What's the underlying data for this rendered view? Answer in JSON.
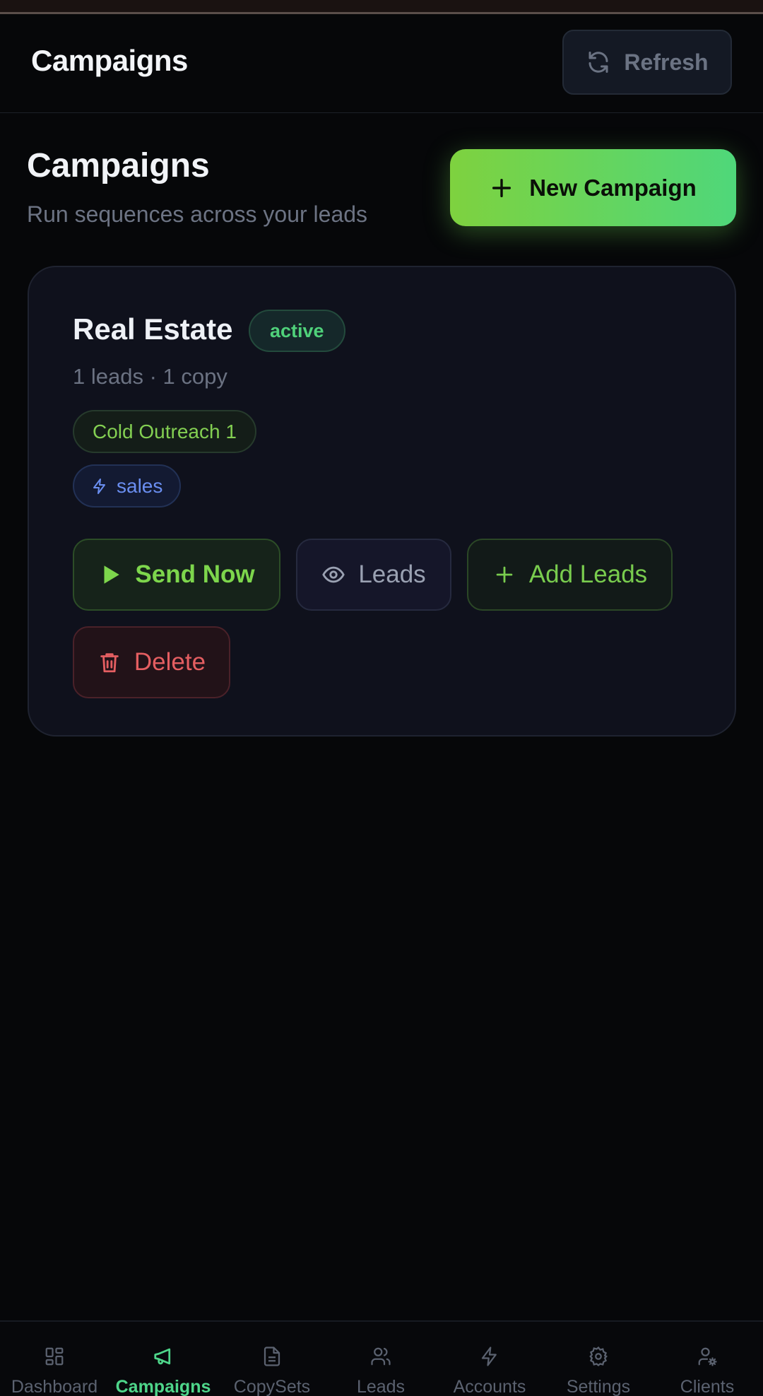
{
  "header": {
    "title": "Campaigns",
    "refresh_label": "Refresh"
  },
  "page": {
    "title": "Campaigns",
    "subtitle": "Run sequences across your leads",
    "new_campaign_label": "New Campaign"
  },
  "campaign": {
    "name": "Real Estate",
    "status": "active",
    "meta": "1 leads · 1 copy",
    "copy_set": "Cold Outreach 1",
    "account_tag": "sales",
    "actions": {
      "send_now": "Send Now",
      "leads": "Leads",
      "add_leads": "Add Leads",
      "delete": "Delete"
    }
  },
  "nav": {
    "active": "Campaigns",
    "items": [
      {
        "label": "Dashboard",
        "icon": "dashboard-icon"
      },
      {
        "label": "Campaigns",
        "icon": "megaphone-icon"
      },
      {
        "label": "CopySets",
        "icon": "document-icon"
      },
      {
        "label": "Leads",
        "icon": "users-icon"
      },
      {
        "label": "Accounts",
        "icon": "lightning-icon"
      },
      {
        "label": "Settings",
        "icon": "gear-icon"
      },
      {
        "label": "Clients",
        "icon": "user-gear-icon"
      }
    ]
  },
  "colors": {
    "accent": "#4ed58a",
    "primary_gradient_start": "#7ed23f",
    "primary_gradient_end": "#4fd77a",
    "danger": "#e45e61",
    "info": "#6a8ef0",
    "background": "#060709"
  }
}
